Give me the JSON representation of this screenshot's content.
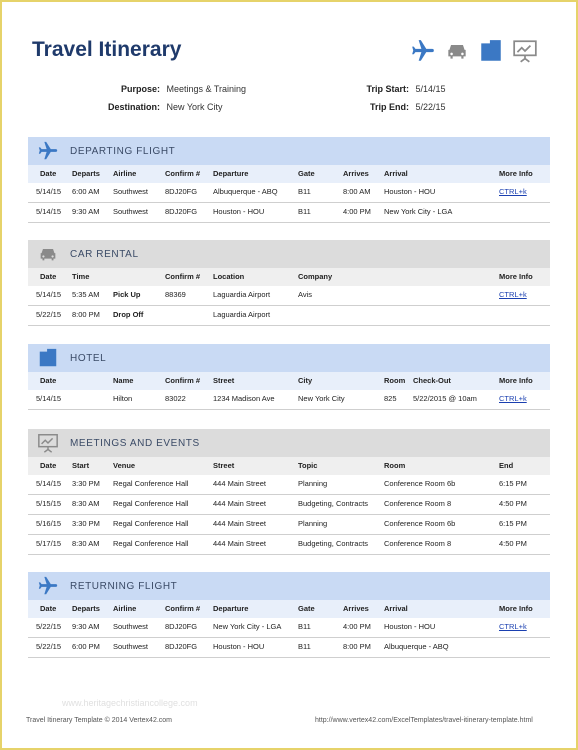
{
  "title": "Travel Itinerary",
  "purpose_label": "Purpose:",
  "purpose": "Meetings & Training",
  "destination_label": "Destination:",
  "destination": "New York City",
  "trip_start_label": "Trip Start:",
  "trip_start": "5/14/15",
  "trip_end_label": "Trip End:",
  "trip_end": "5/22/15",
  "departing": {
    "title": "DEPARTING FLIGHT",
    "cols": [
      "Date",
      "Departs",
      "Airline",
      "Confirm #",
      "Departure",
      "Gate",
      "Arrives",
      "Arrival",
      "More Info"
    ],
    "rows": [
      [
        "5/14/15",
        "6:00 AM",
        "Southwest",
        "8DJ20FG",
        "Albuquerque - ABQ",
        "B11",
        "8:00 AM",
        "Houston - HOU",
        "CTRL+k"
      ],
      [
        "5/14/15",
        "9:30 AM",
        "Southwest",
        "8DJ20FG",
        "Houston - HOU",
        "B11",
        "4:00 PM",
        "New York City - LGA",
        ""
      ]
    ]
  },
  "car": {
    "title": "CAR RENTAL",
    "cols": [
      "Date",
      "Time",
      "Confirm #",
      "Location",
      "Company",
      "More Info"
    ],
    "rows": [
      [
        "5/14/15",
        "5:35 AM",
        "Pick Up",
        "88369",
        "Laguardia Airport",
        "Avis",
        "CTRL+k"
      ],
      [
        "5/22/15",
        "8:00 PM",
        "Drop Off",
        "",
        "Laguardia Airport",
        "",
        ""
      ]
    ]
  },
  "hotel": {
    "title": "HOTEL",
    "cols": [
      "Date",
      "Name",
      "Confirm #",
      "Street",
      "City",
      "Room",
      "Check-Out",
      "More Info"
    ],
    "rows": [
      [
        "5/14/15",
        "Hilton",
        "83022",
        "1234 Madison Ave",
        "New York City",
        "825",
        "5/22/2015 @ 10am",
        "CTRL+k"
      ]
    ]
  },
  "meetings": {
    "title": "MEETINGS AND EVENTS",
    "cols": [
      "Date",
      "Start",
      "Venue",
      "Street",
      "Topic",
      "Room",
      "End"
    ],
    "rows": [
      [
        "5/14/15",
        "3:30 PM",
        "Regal Conference Hall",
        "444 Main Street",
        "Planning",
        "Conference Room 6b",
        "6:15 PM"
      ],
      [
        "5/15/15",
        "8:30 AM",
        "Regal Conference Hall",
        "444 Main Street",
        "Budgeting, Contracts",
        "Conference Room 8",
        "4:50 PM"
      ],
      [
        "5/16/15",
        "3:30 PM",
        "Regal Conference Hall",
        "444 Main Street",
        "Planning",
        "Conference Room 6b",
        "6:15 PM"
      ],
      [
        "5/17/15",
        "8:30 AM",
        "Regal Conference Hall",
        "444 Main Street",
        "Budgeting, Contracts",
        "Conference Room 8",
        "4:50 PM"
      ]
    ]
  },
  "returning": {
    "title": "RETURNING FLIGHT",
    "cols": [
      "Date",
      "Departs",
      "Airline",
      "Confirm #",
      "Departure",
      "Gate",
      "Arrives",
      "Arrival",
      "More Info"
    ],
    "rows": [
      [
        "5/22/15",
        "9:30 AM",
        "Southwest",
        "8DJ20FG",
        "New York City - LGA",
        "B11",
        "4:00 PM",
        "Houston - HOU",
        "CTRL+k"
      ],
      [
        "5/22/15",
        "6:00 PM",
        "Southwest",
        "8DJ20FG",
        "Houston - HOU",
        "B11",
        "8:00 PM",
        "Albuquerque - ABQ",
        ""
      ]
    ]
  },
  "watermark": "www.heritagechristiancollege.com",
  "footer_left": "Travel Itinerary Template © 2014 Vertex42.com",
  "footer_right": "http://www.vertex42.com/ExcelTemplates/travel-itinerary-template.html",
  "colors": {
    "title": "#1f3a6b",
    "icon_blue": "#3b78c4",
    "icon_gray": "#8a8a8a",
    "blue_header": "#c9daf4",
    "gray_header": "#dcdcdc"
  },
  "icons": [
    "airplane-icon",
    "car-icon",
    "building-icon",
    "presentation-icon"
  ]
}
